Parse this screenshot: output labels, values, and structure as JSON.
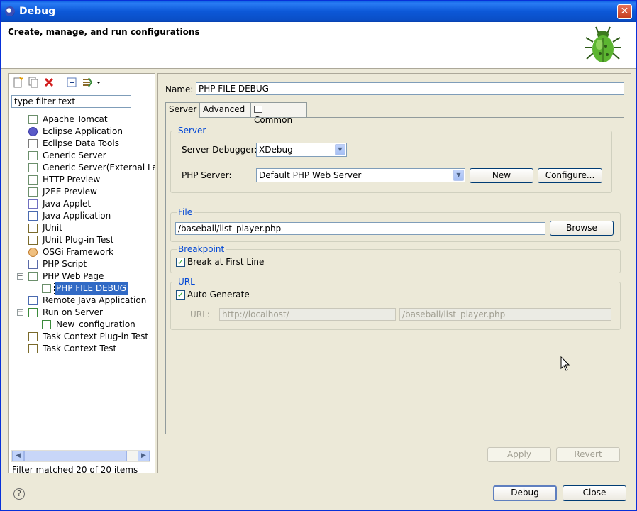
{
  "window": {
    "title": "Debug"
  },
  "header": {
    "title": "Create, manage, and run configurations"
  },
  "left": {
    "filter_placeholder": "type filter text",
    "tree": [
      {
        "label": "Apache Tomcat",
        "icon": "server-icon"
      },
      {
        "label": "Eclipse Application",
        "icon": "eclipse-icon"
      },
      {
        "label": "Eclipse Data Tools",
        "icon": "database-icon"
      },
      {
        "label": "Generic Server",
        "icon": "server-icon"
      },
      {
        "label": "Generic Server(External La",
        "icon": "server-icon"
      },
      {
        "label": "HTTP Preview",
        "icon": "server-icon"
      },
      {
        "label": "J2EE Preview",
        "icon": "server-icon"
      },
      {
        "label": "Java Applet",
        "icon": "applet-icon"
      },
      {
        "label": "Java Application",
        "icon": "java-app-icon"
      },
      {
        "label": "JUnit",
        "icon": "junit-icon"
      },
      {
        "label": "JUnit Plug-in Test",
        "icon": "junit-plugin-icon"
      },
      {
        "label": "OSGi Framework",
        "icon": "osgi-icon"
      },
      {
        "label": "PHP Script",
        "icon": "php-script-icon"
      },
      {
        "label": "PHP Web Page",
        "icon": "server-icon"
      },
      {
        "label": "PHP FILE DEBUG",
        "icon": "server-icon"
      },
      {
        "label": "Remote Java Application",
        "icon": "remote-java-icon"
      },
      {
        "label": "Run on Server",
        "icon": "run-server-icon"
      },
      {
        "label": "New_configuration",
        "icon": "run-server-icon"
      },
      {
        "label": "Task Context Plug-in Test",
        "icon": "task-junit-icon"
      },
      {
        "label": "Task Context Test",
        "icon": "task-junit-icon"
      }
    ],
    "filter_status": "Filter matched 20 of 20 items"
  },
  "right": {
    "name_label": "Name:",
    "name_value": "PHP FILE DEBUG",
    "tabs": [
      "Server",
      "Advanced",
      "Common"
    ],
    "server_group": {
      "title": "Server",
      "debugger_label": "Server Debugger:",
      "debugger_value": "XDebug",
      "php_server_label": "PHP Server:",
      "php_server_value": "Default PHP Web Server",
      "new_label": "New",
      "configure_label": "Configure..."
    },
    "file_group": {
      "title": "File",
      "path": "/baseball/list_player.php",
      "browse_label": "Browse"
    },
    "breakpoint_group": {
      "title": "Breakpoint",
      "break_first_line": "Break at First Line"
    },
    "url_group": {
      "title": "URL",
      "auto_generate": "Auto Generate",
      "url_label": "URL:",
      "url_base": "http://localhost/",
      "url_path": "/baseball/list_player.php"
    },
    "apply_label": "Apply",
    "revert_label": "Revert"
  },
  "footer": {
    "debug_label": "Debug",
    "close_label": "Close"
  },
  "colors": {
    "selection": "#316ac5",
    "group_title": "#0046d5",
    "titlebar": "#0a5fe0"
  }
}
